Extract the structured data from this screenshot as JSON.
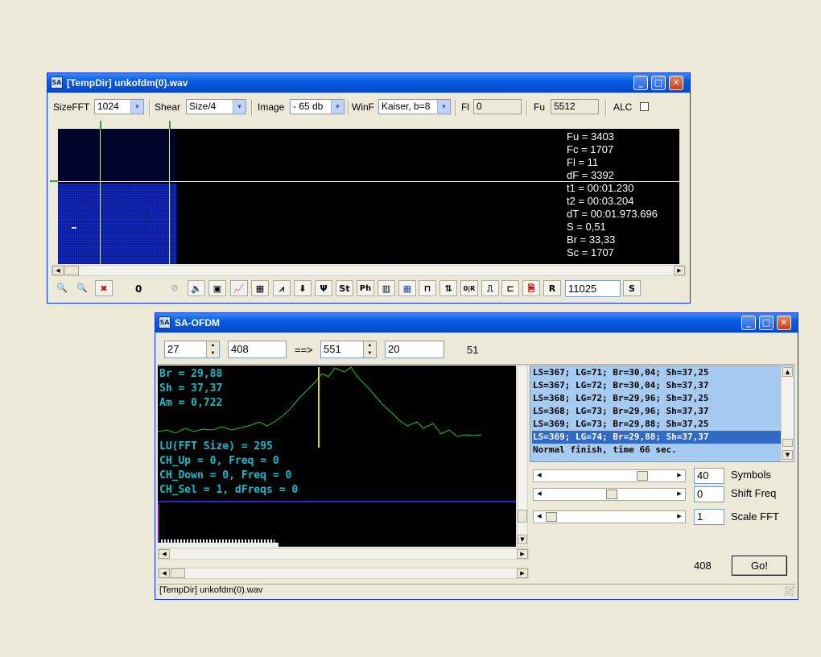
{
  "fft_window": {
    "title": "[TempDir] unkofdm(0).wav",
    "icon": "app-icon",
    "controls": {
      "sizefft_label": "SizeFFT",
      "sizefft_value": "1024",
      "shear_label": "Shear",
      "shear_value": "Size/4",
      "image_label": "Image",
      "image_value": "- 65 db",
      "winf_label": "WinF",
      "winf_value": "Kaiser, b=8",
      "fl_label": "Fl",
      "fl_value": "0",
      "fu_label": "Fu",
      "fu_value": "5512",
      "alc_label": "ALC"
    },
    "readout": [
      "Fu = 3403",
      "Fc = 1707",
      "Fl = 11",
      "dF = 3392",
      "t1 = 00:01.230",
      "t2 = 00:03.204",
      "dT = 00:01.973.696",
      "S = 0,51",
      "Br = 33,33",
      "Sc = 1707"
    ],
    "toolbar": {
      "counter": "0",
      "st_label": "St",
      "ph_label": "Ph",
      "r_label": "R",
      "rate_value": "11025",
      "s_label": "S"
    }
  },
  "ofdm_window": {
    "title": "SA-OFDM",
    "top": {
      "spin1": "27",
      "field1": "408",
      "arrow": "==>",
      "spin2": "551",
      "field2": "20",
      "count": "51"
    },
    "graph_text": [
      "Br = 29,88",
      "Sh = 37,37",
      "Am = 0,722"
    ],
    "graph_text2": [
      "LU(FFT Size) = 295",
      "CH_Up = 0, Freq = 0",
      "CH_Down = 0, Freq = 0",
      "CH_Sel = 1, dFreqs = 0"
    ],
    "list": [
      "LS=367; LG=71; Br=30,04; Sh=37,25",
      "LS=367; LG=72; Br=30,04; Sh=37,37",
      "LS=368; LG=72; Br=29,96; Sh=37,25",
      "LS=368; LG=73; Br=29,96; Sh=37,37",
      "LS=369; LG=73; Br=29,88; Sh=37,25",
      "LS=369; LG=74; Br=29,88; Sh=37,37",
      "Normal finish, time 66 sec."
    ],
    "sliders": {
      "symbols_value": "40",
      "symbols_label": "Symbols",
      "shift_value": "0",
      "shift_label": "Shift Freq",
      "scale_value": "1",
      "scale_label": "Scale FFT"
    },
    "bottom_value": "408",
    "go_label": "Go!",
    "status": "[TempDir] unkofdm(0).wav"
  }
}
